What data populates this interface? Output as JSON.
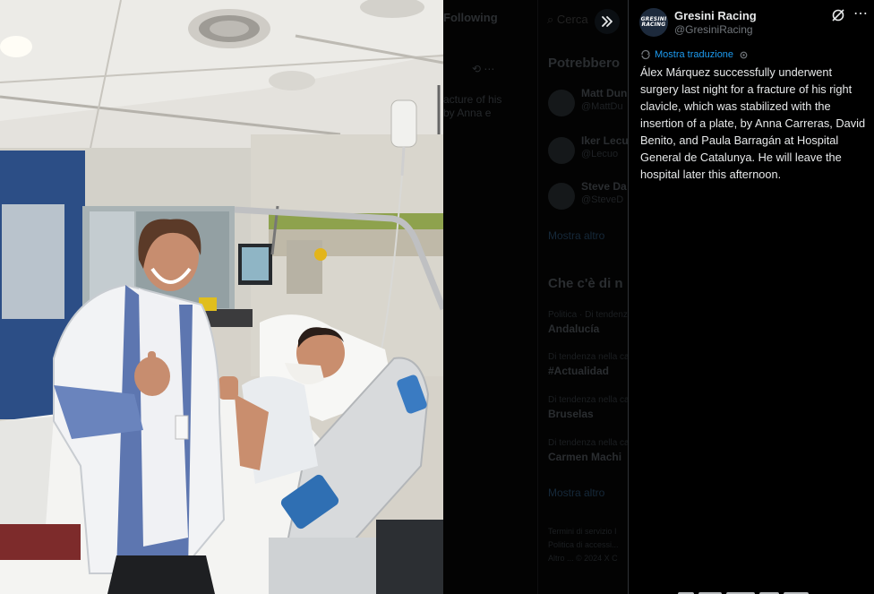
{
  "post": {
    "author_name": "Gresini Racing",
    "author_handle": "@GresiniRacing",
    "avatar_logo_line1": "GRESINI",
    "avatar_logo_line2": "RACING",
    "translation_label": "Mostra traduzione",
    "text": "Álex Márquez successfully underwent surgery last night for a fracture of his right clavicle, which was stabilized with the insertion of a plate, by Anna Carreras, David Benito, and Paula Barragán at Hospital General de Catalunya. He will leave the hospital later this afternoon."
  },
  "background": {
    "tab_following": "Following",
    "search_placeholder": "Cerca",
    "tweet_fragment": "acture of his by Anna e",
    "who_to_follow_title": "Potrebbero",
    "who_to_follow": [
      {
        "name": "Matt Dun",
        "handle": "@MattDu"
      },
      {
        "name": "Iker Lecu",
        "handle": "@Lecuo"
      },
      {
        "name": "Steve Da",
        "handle": "@SteveD"
      }
    ],
    "show_more_1": "Mostra altro",
    "trends_title": "Che c'è di n",
    "trends": [
      {
        "context": "Politica · Di tendenza",
        "topic": "Andalucía"
      },
      {
        "context": "Di tendenza nella cat",
        "topic": "#Actualidad"
      },
      {
        "context": "Di tendenza nella cat",
        "topic": "Bruselas"
      },
      {
        "context": "Di tendenza nella cat",
        "topic": "Carmen Machi"
      }
    ],
    "show_more_2": "Mostra altro",
    "footer_line1": "Termini di servizio  I",
    "footer_line2": "Politica di accessi...",
    "footer_line3": "Altro ...  © 2024 X C"
  },
  "colors": {
    "accent": "#1d9bf0",
    "panel_bg": "#000000",
    "text_primary": "#e7e9ea",
    "text_secondary": "#71767b"
  }
}
